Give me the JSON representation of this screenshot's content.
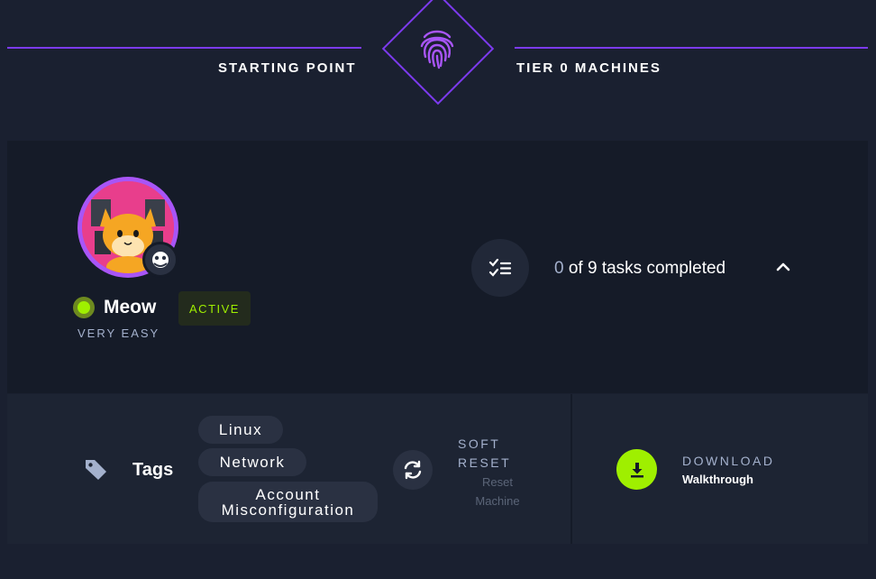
{
  "header": {
    "left_label": "STARTING POINT",
    "right_label": "TIER 0 MACHINES",
    "center_icon": "fingerprint-icon",
    "accent_color": "#7c3aed"
  },
  "machine": {
    "name": "Meow",
    "difficulty": "VERY EASY",
    "status_badge": "ACTIVE",
    "os_icon": "penguin-icon",
    "status_color": "#9fef00"
  },
  "tasks": {
    "completed": "0",
    "rest": " of 9 tasks completed",
    "icon": "checklist-icon",
    "toggle_icon": "chevron-up-icon"
  },
  "tags": {
    "label": "Tags",
    "items": [
      "Linux",
      "Network",
      "Account Misconfiguration"
    ]
  },
  "reset": {
    "title": "SOFT RESET",
    "subtitle": "Reset Machine"
  },
  "download": {
    "title": "DOWNLOAD",
    "subtitle": "Walkthrough"
  }
}
